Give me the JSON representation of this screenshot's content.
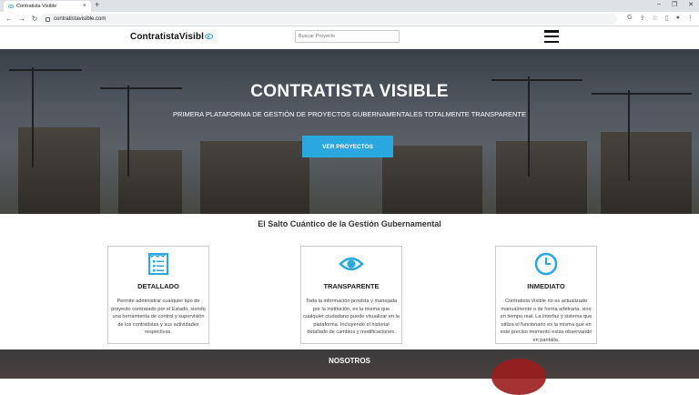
{
  "browser": {
    "tab_title": "Contratista Visible",
    "tab_close": "×",
    "new_tab": "+",
    "url": "contratistavisible.com",
    "win_min": "–",
    "win_max": "❐",
    "win_close": "✕"
  },
  "header": {
    "logo_text": "ContratistaVisibl",
    "search_placeholder": "Buscar Proyecto"
  },
  "hero": {
    "title": "CONTRATISTA VISIBLE",
    "subtitle": "PRIMERA PLATAFORMA DE GESTIÓN DE PROYECTOS GUBERNAMENTALES TOTALMENTE TRANSPARENTE",
    "button_label": "VER PROYECTOS"
  },
  "features": {
    "section_title": "El Salto Cuántico de la Gestión Gubernamental",
    "cards": [
      {
        "icon": "list-document-icon",
        "title": "DETALLADO",
        "text": "Permite administrar cualquier tipo de proyecto contratado por el Estado, siendo una herramienta de control y supervisión de los contratistas y sus actividades respectivas."
      },
      {
        "icon": "eye-icon",
        "title": "TRANSPARENTE",
        "text": "Toda la información provista y manejada por la institución, es la misma que cualquier ciudadano puede visualizar en la plataforma. Incluyendo el historial detallado de cambios y modificaciones."
      },
      {
        "icon": "clock-icon",
        "title": "INMEDIATO",
        "text": "Contratista Visible no es actualizado manualmente o de forma arbitraria, sino en tiempo real. La interfaz y sistema que utiliza el funcionario es la misma que en este preciso momento estás observando en pantalla."
      }
    ]
  },
  "bottom_section": {
    "label": "NOSOTROS"
  },
  "colors": {
    "accent": "#29a8e0"
  }
}
